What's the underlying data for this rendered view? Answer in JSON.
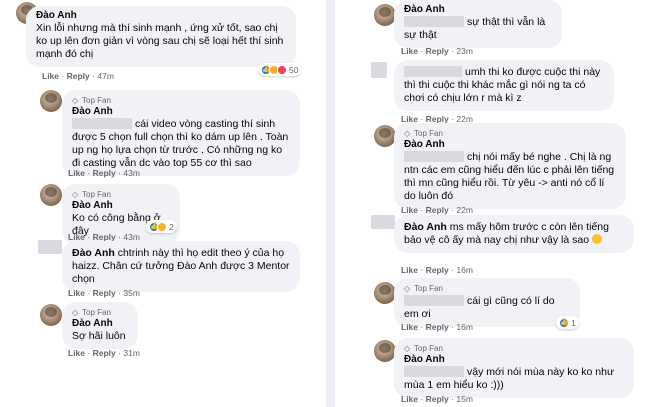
{
  "labels": {
    "top_fan": "Top Fan",
    "like": "Like",
    "reply": "Reply",
    "dot": "·"
  },
  "left": [
    {
      "author": "Đào Anh",
      "text": "Xin lỗi nhưng mà thí sinh mạnh , ứng xử tốt, sao chị ko up lên đơn giản vì vòng sau chị sẽ loại hết thí sinh mạnh đó chị",
      "time": "47m",
      "reactions": "50"
    },
    {
      "author": "Đào Anh",
      "text": "cái video vòng casting thí sinh được 5 chọn full chọn thì ko dám up lên . Toàn up ng họ lựa chọn từ trước . Có những ng ko đi casting vẫn dc vào top 55 cơ thì sao",
      "time": "43m"
    },
    {
      "author": "Đào Anh",
      "text": "Ko có công bằng ở đây",
      "time": "43m",
      "reactions": "2"
    },
    {
      "author": "Đào Anh",
      "text": "chtrinh này thì họ edit theo ý của họ haizz. Chân cứ tưởng Đào Anh được 3 Mentor chọn",
      "time": "35m"
    },
    {
      "author": "Đào Anh",
      "text": "Sợ hãi luôn",
      "time": "31m"
    }
  ],
  "right": [
    {
      "author": "Đào Anh",
      "text": "sự thật thì vẫn là sự thật",
      "time": "23m"
    },
    {
      "text": "umh thi ko được cuộc thi này thì thi cuộc thi khác mắc gì nói ng ta có chơi có chịu lớn r mà kì z",
      "time": "22m"
    },
    {
      "author": "Đào Anh",
      "text": "chị nói mấy bé nghe . Chị là ng ntn các em cũng hiểu đến lúc c phải lên tiếng thì mn cũng hiểu rồi. Từ yêu -> anti nó cổ lí do luôn đó",
      "time": "22m"
    },
    {
      "inline_author": "Đào Anh",
      "text": "ms mấy hôm trước c còn lên tiếng bảo vệ cô ấy mà nay chị như vậy là sao",
      "time": "16m"
    },
    {
      "text": "cái gì cũng có lí do em ơi",
      "time": "16m",
      "reactions": "1"
    },
    {
      "author": "Đào Anh",
      "text": "vậy mới nói mùa này ko ko như mùa 1 em hiểu ko :)))",
      "time": "15m"
    }
  ]
}
